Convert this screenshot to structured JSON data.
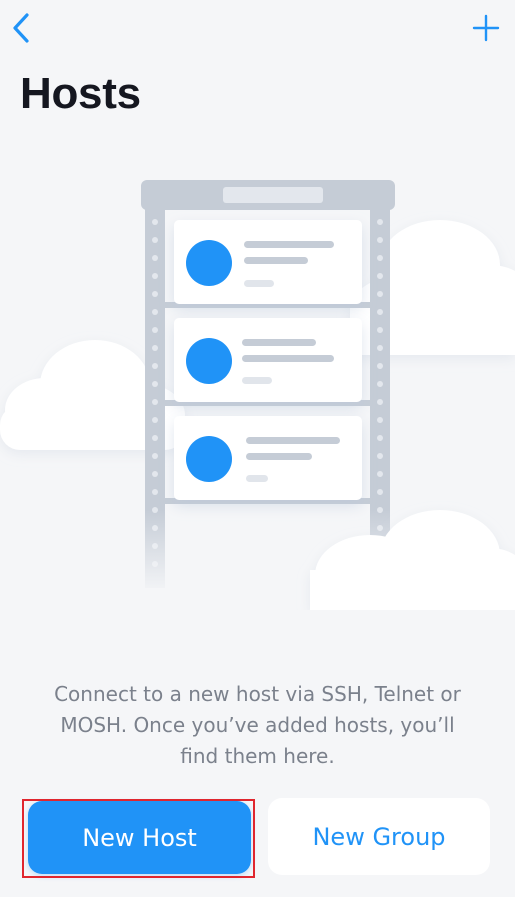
{
  "nav": {
    "back_icon": "chevron-left-icon",
    "add_icon": "plus-icon"
  },
  "page": {
    "title": "Hosts"
  },
  "empty_state": {
    "illustration": "server-rack-with-clouds",
    "message": "Connect to a new host via SSH, Telnet or MOSH. Once you’ve added hosts, you’ll find them here."
  },
  "actions": {
    "new_host_label": "New Host",
    "new_group_label": "New Group"
  },
  "colors": {
    "accent": "#2093f7",
    "title": "#151720",
    "message": "#7b818c",
    "background": "#f5f6f8",
    "highlight": "#e0262e"
  }
}
